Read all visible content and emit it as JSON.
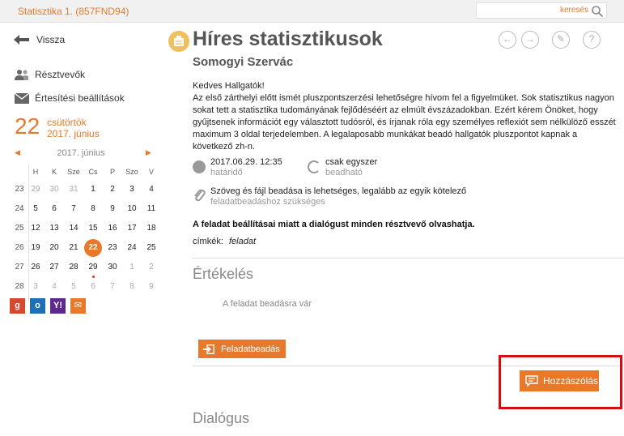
{
  "topbar": {
    "course_title": "Statisztika 1. (857FND94)",
    "search_label": "keresés"
  },
  "nav": {
    "back_label": "Vissza",
    "participants_label": "Résztvevők",
    "notifications_label": "Értesítési beállítások"
  },
  "date": {
    "day": "22",
    "weekday": "csütörtök",
    "full": "2017. június"
  },
  "calendar": {
    "month_label": "2017. június",
    "headers": [
      "H",
      "K",
      "Sze",
      "Cs",
      "P",
      "Szo",
      "V"
    ],
    "rows": [
      {
        "week": "23",
        "days": [
          {
            "d": "29",
            "o": true
          },
          {
            "d": "30",
            "o": true
          },
          {
            "d": "31",
            "o": true
          },
          {
            "d": "1"
          },
          {
            "d": "2"
          },
          {
            "d": "3"
          },
          {
            "d": "4"
          }
        ]
      },
      {
        "week": "24",
        "days": [
          {
            "d": "5"
          },
          {
            "d": "6"
          },
          {
            "d": "7"
          },
          {
            "d": "8"
          },
          {
            "d": "9"
          },
          {
            "d": "10"
          },
          {
            "d": "11"
          }
        ]
      },
      {
        "week": "25",
        "days": [
          {
            "d": "12"
          },
          {
            "d": "13"
          },
          {
            "d": "14"
          },
          {
            "d": "15"
          },
          {
            "d": "16"
          },
          {
            "d": "17"
          },
          {
            "d": "18"
          }
        ]
      },
      {
        "week": "26",
        "days": [
          {
            "d": "19"
          },
          {
            "d": "20"
          },
          {
            "d": "21"
          },
          {
            "d": "22",
            "today": true
          },
          {
            "d": "23"
          },
          {
            "d": "24"
          },
          {
            "d": "25"
          }
        ]
      },
      {
        "week": "27",
        "days": [
          {
            "d": "26"
          },
          {
            "d": "27"
          },
          {
            "d": "28"
          },
          {
            "d": "29",
            "dot": true
          },
          {
            "d": "30"
          },
          {
            "d": "1",
            "o": true
          },
          {
            "d": "2",
            "o": true
          }
        ]
      },
      {
        "week": "28",
        "days": [
          {
            "d": "3",
            "o": true
          },
          {
            "d": "4",
            "o": true
          },
          {
            "d": "5",
            "o": true
          },
          {
            "d": "6",
            "o": true
          },
          {
            "d": "7",
            "o": true
          },
          {
            "d": "8",
            "o": true
          },
          {
            "d": "9",
            "o": true
          }
        ]
      }
    ]
  },
  "sync_icons": [
    {
      "name": "google-calendar-icon",
      "glyph": "g",
      "color": "#d6492f"
    },
    {
      "name": "outlook-icon",
      "glyph": "o",
      "color": "#1f6fb8"
    },
    {
      "name": "yahoo-icon",
      "glyph": "Y!",
      "color": "#5b2a8a"
    },
    {
      "name": "ical-icon",
      "glyph": "✉",
      "color": "#e8792b"
    }
  ],
  "assignment": {
    "title": "Híres statisztikusok",
    "author": "Somogyi Szervác",
    "greeting": "Kedves Hallgatók!",
    "body": "Az első zárthelyi előtt ismét pluszpontszerzési lehetőségre hívom fel a figyelmüket. Sok statisztikus nagyon sokat tett a statisztika tudományának fejlődéséért az elmúlt évszázadokban. Ezért kérem Önöket, hogy gyűjtsenek információt egy választott tudósról, és írjanak róla egy személyes reflexiót sem nélkülöző esszét maximum 3 oldal terjedelemben. A legalaposabb munkákat beadó hallgatók pluszpontot kapnak a következő zh-n.",
    "deadline_value": "2017.06.29. 12:35",
    "deadline_label": "határidő",
    "submit_times_value": "csak egyszer",
    "submit_times_label": "beadható",
    "submit_type_value": "Szöveg és fájl beadása is lehetséges, legalább az egyik kötelező",
    "submit_type_label": "feladatbeadáshoz szükséges",
    "notice": "A feladat beállításai miatt a dialógust minden résztvevő olvashatja.",
    "tags_label": "címkék:",
    "tag": "feladat"
  },
  "evaluation": {
    "title": "Értékelés",
    "await_text": "A feladat beadásra vár"
  },
  "buttons": {
    "submit": "Feladatbeadás",
    "comment": "Hozzászólás"
  },
  "dialog": {
    "title": "Dialógus"
  },
  "colors": {
    "accent": "#e8792b",
    "highlight": "#d60d0d"
  }
}
